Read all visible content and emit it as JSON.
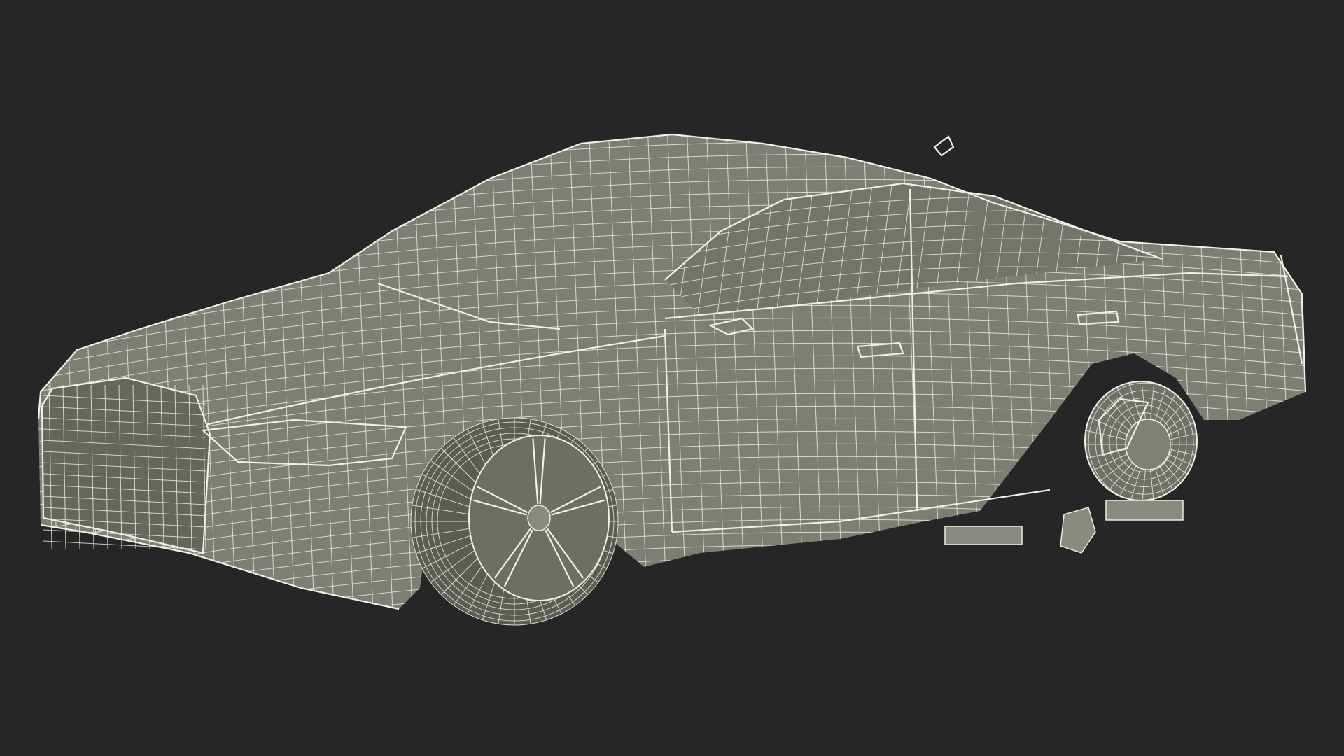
{
  "scene": {
    "subject": "wireframe-sedan-3d-model",
    "colors": {
      "background": "#262626",
      "body": "#7e7e72",
      "wire": "#e8e8dc"
    }
  }
}
